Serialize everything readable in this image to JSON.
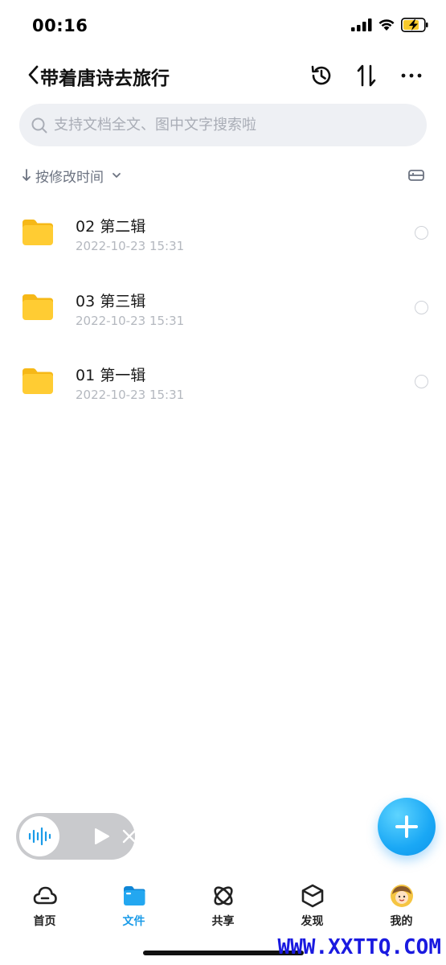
{
  "status_bar": {
    "time": "00:16"
  },
  "nav": {
    "title": "带着唐诗去旅行"
  },
  "search": {
    "placeholder": "支持文档全文、图中文字搜索啦"
  },
  "sort": {
    "label": "按修改时间"
  },
  "files": [
    {
      "name": "02 第二辑",
      "date": "2022-10-23 15:31"
    },
    {
      "name": "03 第三辑",
      "date": "2022-10-23 15:31"
    },
    {
      "name": "01 第一辑",
      "date": "2022-10-23 15:31"
    }
  ],
  "tabs": [
    {
      "label": "首页",
      "icon": "cloud-icon"
    },
    {
      "label": "文件",
      "icon": "folder-icon"
    },
    {
      "label": "共享",
      "icon": "atom-icon"
    },
    {
      "label": "发现",
      "icon": "cube-icon"
    },
    {
      "label": "我的",
      "icon": "avatar"
    }
  ],
  "watermark": "WWW.XXTTQ.COM",
  "colors": {
    "accent": "#1a9be8",
    "folder": "#ffc928",
    "fab": "#1aa8f5"
  }
}
